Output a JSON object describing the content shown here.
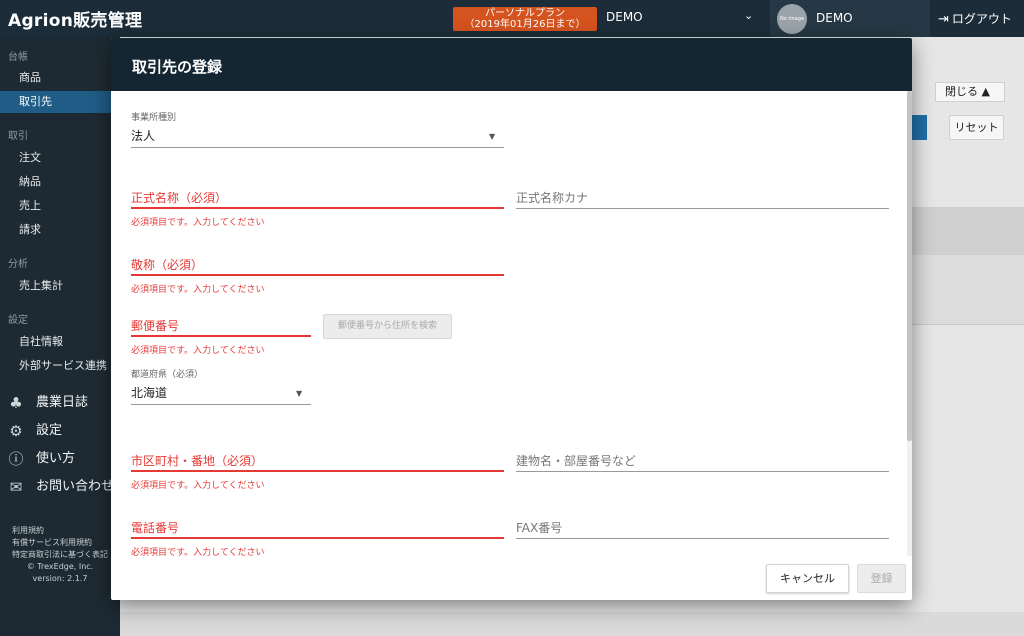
{
  "app": {
    "brand": "Agrion販売管理",
    "plan_line1": "パーソナルプラン",
    "plan_line2": "（2019年01月26日まで）",
    "org_name": "DEMO",
    "avatar_text": "No image",
    "user_name": "DEMO",
    "logout_label": "ログアウト"
  },
  "sidebar": {
    "section_ledger": "台帳",
    "item_products": "商品",
    "item_partners": "取引先",
    "section_trade": "取引",
    "item_orders": "注文",
    "item_delivery": "納品",
    "item_sales": "売上",
    "item_billing": "請求",
    "section_analysis": "分析",
    "item_sales_summary": "売上集計",
    "section_settings": "設定",
    "item_company": "自社情報",
    "item_external": "外部サービス連携",
    "big_diary": "農業日誌",
    "big_settings": "設定",
    "big_help": "使い方",
    "big_contact": "お問い合わせ",
    "footer_terms": "利用規約",
    "footer_paid_terms": "有償サービス利用規約",
    "footer_commerce": "特定商取引法に基づく表記",
    "footer_copyright": "© TrexEdge, Inc.",
    "footer_version": "version: 2.1.7"
  },
  "background": {
    "close_label": "閉じる ▲",
    "reset_label": "リセット"
  },
  "modal": {
    "title": "取引先の登録",
    "office_type": {
      "label": "事業所種別",
      "value": "法人"
    },
    "official_name": {
      "label": "正式名称（必須）",
      "error": "必須項目です。入力してください"
    },
    "official_name_kana": {
      "label": "正式名称カナ"
    },
    "honorific": {
      "label": "敬称（必須）",
      "error": "必須項目です。入力してください"
    },
    "postal_code": {
      "label": "郵便番号",
      "error": "必須項目です。入力してください"
    },
    "zip_search_button": "郵便番号から住所を検索",
    "prefecture": {
      "label": "都道府県（必須）",
      "value": "北海道"
    },
    "city_address": {
      "label": "市区町村・番地（必須）",
      "error": "必須項目です。入力してください"
    },
    "building": {
      "label": "建物名・部屋番号など"
    },
    "phone": {
      "label": "電話番号",
      "error": "必須項目です。入力してください"
    },
    "fax": {
      "label": "FAX番号"
    },
    "cancel_label": "キャンセル",
    "submit_label": "登録"
  }
}
